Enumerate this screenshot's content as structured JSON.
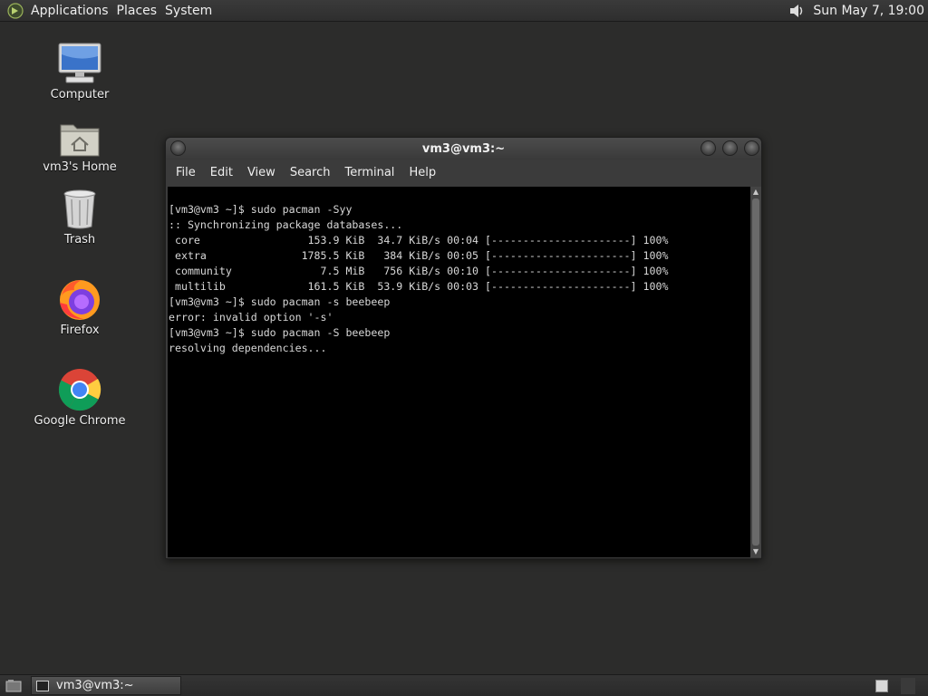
{
  "top_panel": {
    "menus": [
      "Applications",
      "Places",
      "System"
    ],
    "clock": "Sun May  7, 19:00"
  },
  "desktop_icons": [
    {
      "label": "Computer",
      "icon": "computer-icon"
    },
    {
      "label": "vm3's Home",
      "icon": "home-folder-icon"
    },
    {
      "label": "Trash",
      "icon": "trash-icon"
    },
    {
      "label": "Firefox",
      "icon": "firefox-icon"
    },
    {
      "label": "Google Chrome",
      "icon": "chrome-icon"
    }
  ],
  "terminal": {
    "title": "vm3@vm3:~",
    "menu": [
      "File",
      "Edit",
      "View",
      "Search",
      "Terminal",
      "Help"
    ],
    "lines": [
      "[vm3@vm3 ~]$ sudo pacman -Syy",
      ":: Synchronizing package databases...",
      " core                 153.9 KiB  34.7 KiB/s 00:04 [----------------------] 100%",
      " extra               1785.5 KiB   384 KiB/s 00:05 [----------------------] 100%",
      " community              7.5 MiB   756 KiB/s 00:10 [----------------------] 100%",
      " multilib             161.5 KiB  53.9 KiB/s 00:03 [----------------------] 100%",
      "[vm3@vm3 ~]$ sudo pacman -s beebeep",
      "error: invalid option '-s'",
      "[vm3@vm3 ~]$ sudo pacman -S beebeep",
      "resolving dependencies..."
    ]
  },
  "taskbar": {
    "task_label": "vm3@vm3:~"
  },
  "colors": {
    "desktop_bg": "#2c2c2b",
    "terminal_bg": "#000000",
    "terminal_text": "#d8d8d8"
  }
}
